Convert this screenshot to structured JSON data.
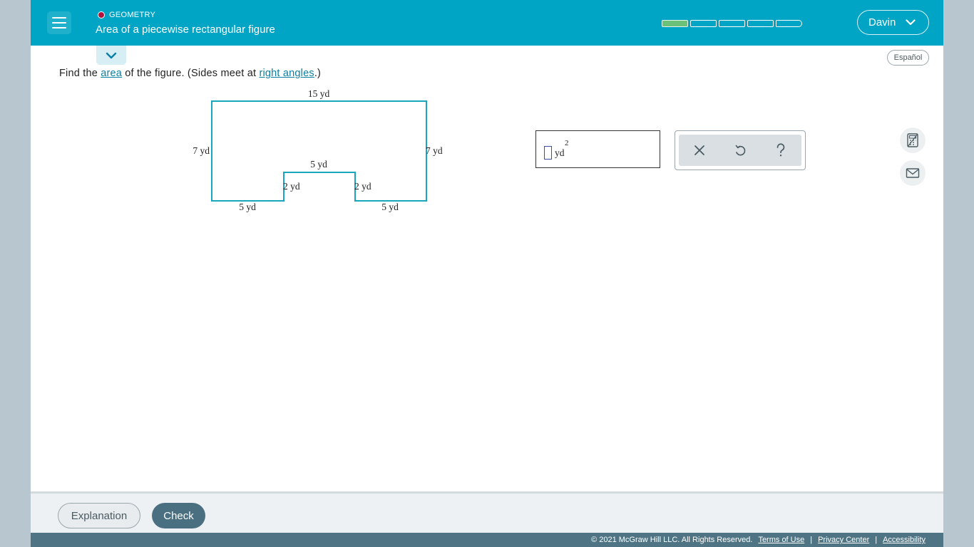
{
  "header": {
    "topic": "GEOMETRY",
    "title": "Area of a piecewise rectangular figure",
    "progress": {
      "filled": 1,
      "total": 5
    },
    "user": "Davin",
    "colors": {
      "header": "#00a4c4",
      "progress_filled": "#6cc17a",
      "topic_dot": "#b0123c"
    }
  },
  "language_button": "Español",
  "question": {
    "prefix": "Find the ",
    "link1": "area",
    "middle": " of the figure. (Sides meet at ",
    "link2": "right angles",
    "suffix": ".)"
  },
  "figure": {
    "labels": {
      "top": "15  yd",
      "left": "7  yd",
      "right": "7  yd",
      "notch_top": "5  yd",
      "notch_left": "2  yd",
      "notch_right": "2  yd",
      "bottom_left": "5  yd",
      "bottom_right": "5  yd"
    },
    "stroke_color": "#1aa6bf"
  },
  "answer": {
    "value": "",
    "unit": "yd",
    "exponent": "2"
  },
  "tools": [
    "clear-icon",
    "undo-icon",
    "help-icon"
  ],
  "side_tools": [
    "calculator-icon",
    "mail-icon"
  ],
  "footer": {
    "explanation": "Explanation",
    "check": "Check",
    "copyright": "2021 McGraw Hill LLC. All Rights Reserved.",
    "links": [
      "Terms of Use",
      "Privacy Center",
      "Accessibility"
    ],
    "separator": "|"
  }
}
